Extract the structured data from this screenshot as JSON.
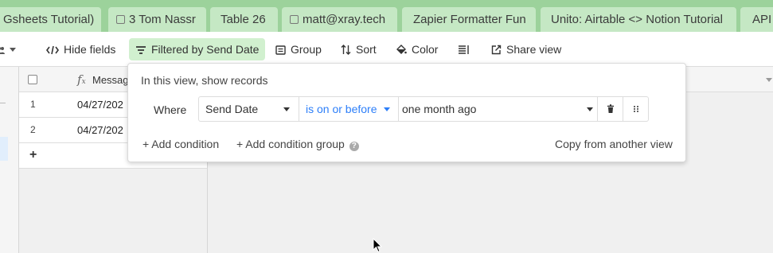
{
  "tabs": [
    {
      "label": "Gsheets Tutorial)",
      "icon": ""
    },
    {
      "label": "3 Tom Nassr",
      "icon": "grid-icon"
    },
    {
      "label": "Table 26",
      "icon": ""
    },
    {
      "label": "matt@xray.tech",
      "icon": "grid-icon"
    },
    {
      "label": "Zapier Formatter Fun",
      "icon": ""
    },
    {
      "label": "Unito: Airtable <> Notion Tutorial",
      "icon": ""
    },
    {
      "label": "API",
      "icon": ""
    }
  ],
  "toolbar": {
    "hide_fields": "Hide fields",
    "filtered": "Filtered by Send Date",
    "group": "Group",
    "sort": "Sort",
    "color": "Color",
    "share_view": "Share view"
  },
  "grid": {
    "column_header": "Messag",
    "rows": [
      {
        "num": "1",
        "value": "04/27/202"
      },
      {
        "num": "2",
        "value": "04/27/202"
      }
    ],
    "add_row": "+"
  },
  "filter_popover": {
    "title": "In this view, show records",
    "where_label": "Where",
    "field": "Send Date",
    "operator": "is on or before",
    "value": "one month ago",
    "add_condition": "+ Add condition",
    "add_condition_group": "+ Add condition group",
    "copy_from": "Copy from another view"
  },
  "colors": {
    "tabbar_bg": "#9cd29b",
    "tab_bg": "#c5e8c4",
    "active_filter_bg": "#d1f0cf",
    "operator_text": "#2d7ff9"
  }
}
